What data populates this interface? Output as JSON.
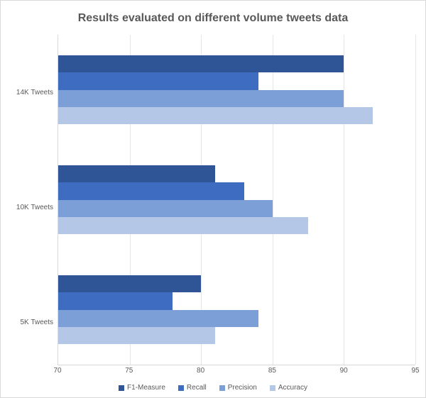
{
  "chart_data": {
    "type": "bar",
    "orientation": "horizontal",
    "title": "Results evaluated on different volume tweets data",
    "xlabel": "",
    "ylabel": "",
    "xlim": [
      70,
      95
    ],
    "x_ticks": [
      70,
      75,
      80,
      85,
      90,
      95
    ],
    "categories": [
      "14K Tweets",
      "10K Tweets",
      "5K Tweets"
    ],
    "series": [
      {
        "name": "F1-Measure",
        "color": "#2f5597",
        "values": [
          90,
          81,
          80
        ]
      },
      {
        "name": "Recall",
        "color": "#3e6cc0",
        "values": [
          84,
          83,
          78
        ]
      },
      {
        "name": "Precision",
        "color": "#7c9fd8",
        "values": [
          90,
          85,
          84
        ]
      },
      {
        "name": "Accuracy",
        "color": "#b4c7e7",
        "values": [
          92,
          87.5,
          81
        ]
      }
    ],
    "legend_position": "bottom",
    "grid": true
  }
}
